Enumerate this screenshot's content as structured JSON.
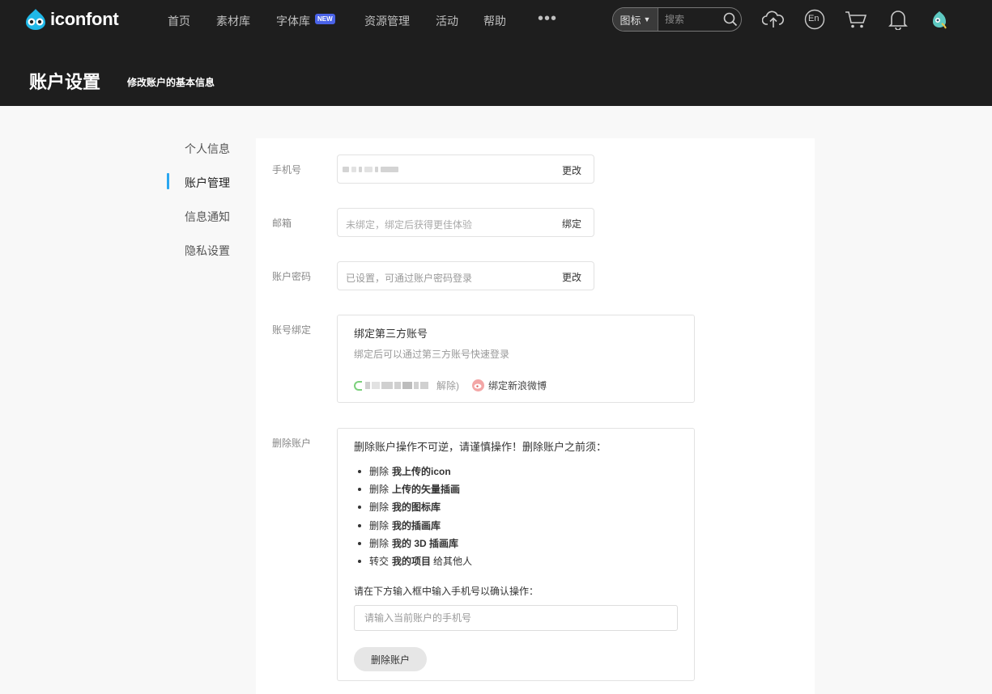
{
  "header": {
    "logo_text": "iconfont",
    "nav": [
      "首页",
      "素材库",
      "字体库",
      "资源管理",
      "活动",
      "帮助"
    ],
    "new_badge": "NEW",
    "more": "•••",
    "search": {
      "type_label": "图标",
      "placeholder": "搜索"
    },
    "lang_label": "En",
    "icons": [
      "cloud-upload-icon",
      "language-icon",
      "cart-icon",
      "bell-icon",
      "avatar"
    ],
    "page_title": "账户设置",
    "page_subtitle": "修改账户的基本信息"
  },
  "sidebar": {
    "items": [
      {
        "label": "个人信息",
        "active": false
      },
      {
        "label": "账户管理",
        "active": true
      },
      {
        "label": "信息通知",
        "active": false
      },
      {
        "label": "隐私设置",
        "active": false
      }
    ],
    "accent": "#2aa7f0"
  },
  "account": {
    "phone": {
      "label": "手机号",
      "action": "更改"
    },
    "email": {
      "label": "邮箱",
      "value": "未绑定，绑定后获得更佳体验",
      "action": "绑定"
    },
    "password": {
      "label": "账户密码",
      "value": "已设置，可通过账户密码登录",
      "action": "更改"
    },
    "binding": {
      "label": "账号绑定",
      "title": "绑定第三方账号",
      "desc": "绑定后可以通过第三方账号快速登录",
      "wechat_suffix": "解除)",
      "weibo": "绑定新浪微博"
    },
    "delete": {
      "label": "删除账户",
      "title": "删除账户操作不可逆，请谨慎操作！删除账户之前须：",
      "items": [
        {
          "prefix": "删除",
          "bold": "我上传的icon",
          "suffix": ""
        },
        {
          "prefix": "删除",
          "bold": "上传的矢量插画",
          "suffix": ""
        },
        {
          "prefix": "删除",
          "bold": "我的图标库",
          "suffix": ""
        },
        {
          "prefix": "删除",
          "bold": "我的插画库",
          "suffix": ""
        },
        {
          "prefix": "删除",
          "bold": "我的 3D 插画库",
          "suffix": ""
        },
        {
          "prefix": "转交",
          "bold": "我的项目",
          "suffix": "给其他人"
        }
      ],
      "confirm_label": "请在下方输入框中输入手机号以确认操作：",
      "confirm_placeholder": "请输入当前账户的手机号",
      "button": "删除账户"
    }
  }
}
